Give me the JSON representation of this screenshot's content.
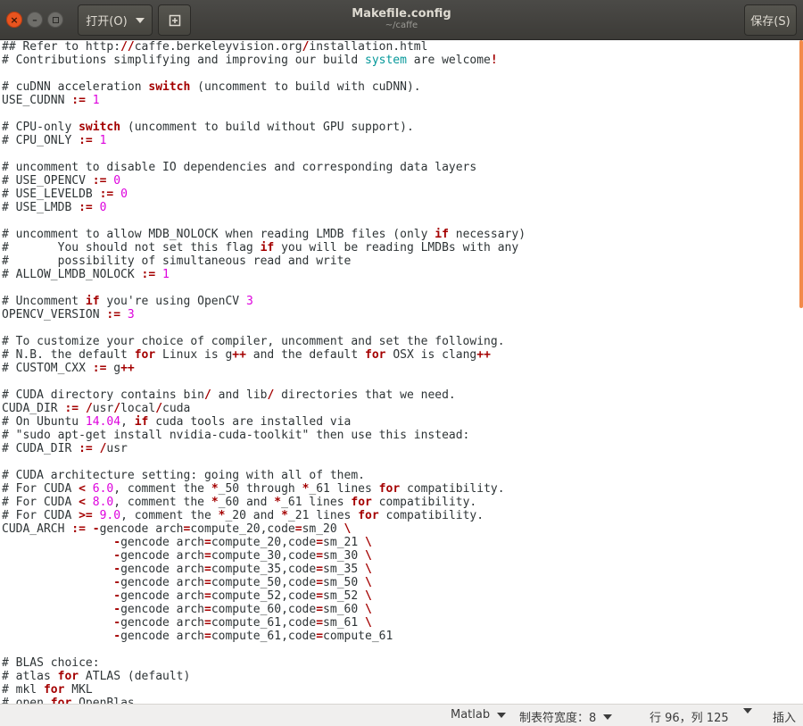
{
  "window": {
    "title": "Makefile.config",
    "subtitle": "~/caffe",
    "close_glyph": "×",
    "min_glyph": "–"
  },
  "toolbar": {
    "open_label": "打开(O)",
    "save_label": "保存(S)",
    "new_tab_icon": "document-new-icon"
  },
  "editor": {
    "lines": [
      [
        {
          "t": "## Refer to http:"
        },
        {
          "t": "//",
          "c": "kw"
        },
        {
          "t": "caffe.berkeleyvision.org"
        },
        {
          "t": "/",
          "c": "kw"
        },
        {
          "t": "installation.html"
        }
      ],
      [
        {
          "t": "# Contributions simplifying and improving our build "
        },
        {
          "t": "system",
          "c": "bi"
        },
        {
          "t": " are welcome"
        },
        {
          "t": "!",
          "c": "kw"
        }
      ],
      [],
      [
        {
          "t": "# cuDNN acceleration "
        },
        {
          "t": "switch",
          "c": "kw"
        },
        {
          "t": " (uncomment to build with cuDNN)."
        }
      ],
      [
        {
          "t": "USE_CUDNN "
        },
        {
          "t": ":=",
          "c": "kw"
        },
        {
          "t": " "
        },
        {
          "t": "1",
          "c": "num"
        }
      ],
      [],
      [
        {
          "t": "# CPU-only "
        },
        {
          "t": "switch",
          "c": "kw"
        },
        {
          "t": " (uncomment to build without GPU support)."
        }
      ],
      [
        {
          "t": "# CPU_ONLY "
        },
        {
          "t": ":=",
          "c": "kw"
        },
        {
          "t": " "
        },
        {
          "t": "1",
          "c": "num"
        }
      ],
      [],
      [
        {
          "t": "# uncomment to disable IO dependencies and corresponding data layers"
        }
      ],
      [
        {
          "t": "# USE_OPENCV "
        },
        {
          "t": ":=",
          "c": "kw"
        },
        {
          "t": " "
        },
        {
          "t": "0",
          "c": "num"
        }
      ],
      [
        {
          "t": "# USE_LEVELDB "
        },
        {
          "t": ":=",
          "c": "kw"
        },
        {
          "t": " "
        },
        {
          "t": "0",
          "c": "num"
        }
      ],
      [
        {
          "t": "# USE_LMDB "
        },
        {
          "t": ":=",
          "c": "kw"
        },
        {
          "t": " "
        },
        {
          "t": "0",
          "c": "num"
        }
      ],
      [],
      [
        {
          "t": "# uncomment to allow MDB_NOLOCK when reading LMDB files (only "
        },
        {
          "t": "if",
          "c": "kw"
        },
        {
          "t": " necessary)"
        }
      ],
      [
        {
          "t": "#       You should not set this flag "
        },
        {
          "t": "if",
          "c": "kw"
        },
        {
          "t": " you will be reading LMDBs with any"
        }
      ],
      [
        {
          "t": "#       possibility of simultaneous read and write"
        }
      ],
      [
        {
          "t": "# ALLOW_LMDB_NOLOCK "
        },
        {
          "t": ":=",
          "c": "kw"
        },
        {
          "t": " "
        },
        {
          "t": "1",
          "c": "num"
        }
      ],
      [],
      [
        {
          "t": "# Uncomment "
        },
        {
          "t": "if",
          "c": "kw"
        },
        {
          "t": " you're using OpenCV "
        },
        {
          "t": "3",
          "c": "num"
        }
      ],
      [
        {
          "t": "OPENCV_VERSION "
        },
        {
          "t": ":=",
          "c": "kw"
        },
        {
          "t": " "
        },
        {
          "t": "3",
          "c": "num"
        }
      ],
      [],
      [
        {
          "t": "# To customize your choice of compiler, uncomment and set the following."
        }
      ],
      [
        {
          "t": "# N.B. the default "
        },
        {
          "t": "for",
          "c": "kw"
        },
        {
          "t": " Linux is g"
        },
        {
          "t": "++",
          "c": "kw"
        },
        {
          "t": " and the default "
        },
        {
          "t": "for",
          "c": "kw"
        },
        {
          "t": " OSX is clang"
        },
        {
          "t": "++",
          "c": "kw"
        }
      ],
      [
        {
          "t": "# CUSTOM_CXX "
        },
        {
          "t": ":=",
          "c": "kw"
        },
        {
          "t": " g"
        },
        {
          "t": "++",
          "c": "kw"
        }
      ],
      [],
      [
        {
          "t": "# CUDA directory contains bin"
        },
        {
          "t": "/",
          "c": "kw"
        },
        {
          "t": " and lib"
        },
        {
          "t": "/",
          "c": "kw"
        },
        {
          "t": " directories that we need."
        }
      ],
      [
        {
          "t": "CUDA_DIR "
        },
        {
          "t": ":=",
          "c": "kw"
        },
        {
          "t": " "
        },
        {
          "t": "/",
          "c": "kw"
        },
        {
          "t": "usr"
        },
        {
          "t": "/",
          "c": "kw"
        },
        {
          "t": "local"
        },
        {
          "t": "/",
          "c": "kw"
        },
        {
          "t": "cuda"
        }
      ],
      [
        {
          "t": "# On Ubuntu "
        },
        {
          "t": "14.04",
          "c": "num"
        },
        {
          "t": ", "
        },
        {
          "t": "if",
          "c": "kw"
        },
        {
          "t": " cuda tools are installed via"
        }
      ],
      [
        {
          "t": "# \"sudo apt-get install nvidia-cuda-toolkit\" then use this instead:"
        }
      ],
      [
        {
          "t": "# CUDA_DIR "
        },
        {
          "t": ":=",
          "c": "kw"
        },
        {
          "t": " "
        },
        {
          "t": "/",
          "c": "kw"
        },
        {
          "t": "usr"
        }
      ],
      [],
      [
        {
          "t": "# CUDA architecture setting: going with all of them."
        }
      ],
      [
        {
          "t": "# For CUDA "
        },
        {
          "t": "<",
          "c": "kw"
        },
        {
          "t": " "
        },
        {
          "t": "6.0",
          "c": "num"
        },
        {
          "t": ", comment the "
        },
        {
          "t": "*",
          "c": "kw"
        },
        {
          "t": "_50 through "
        },
        {
          "t": "*",
          "c": "kw"
        },
        {
          "t": "_61 lines "
        },
        {
          "t": "for",
          "c": "kw"
        },
        {
          "t": " compatibility."
        }
      ],
      [
        {
          "t": "# For CUDA "
        },
        {
          "t": "<",
          "c": "kw"
        },
        {
          "t": " "
        },
        {
          "t": "8.0",
          "c": "num"
        },
        {
          "t": ", comment the "
        },
        {
          "t": "*",
          "c": "kw"
        },
        {
          "t": "_60 and "
        },
        {
          "t": "*",
          "c": "kw"
        },
        {
          "t": "_61 lines "
        },
        {
          "t": "for",
          "c": "kw"
        },
        {
          "t": " compatibility."
        }
      ],
      [
        {
          "t": "# For CUDA "
        },
        {
          "t": ">=",
          "c": "kw"
        },
        {
          "t": " "
        },
        {
          "t": "9.0",
          "c": "num"
        },
        {
          "t": ", comment the "
        },
        {
          "t": "*",
          "c": "kw"
        },
        {
          "t": "_20 and "
        },
        {
          "t": "*",
          "c": "kw"
        },
        {
          "t": "_21 lines "
        },
        {
          "t": "for",
          "c": "kw"
        },
        {
          "t": " compatibility."
        }
      ],
      [
        {
          "t": "CUDA_ARCH "
        },
        {
          "t": ":=",
          "c": "kw"
        },
        {
          "t": " "
        },
        {
          "t": "-",
          "c": "kw"
        },
        {
          "t": "gencode arch"
        },
        {
          "t": "=",
          "c": "kw"
        },
        {
          "t": "compute_20,code"
        },
        {
          "t": "=",
          "c": "kw"
        },
        {
          "t": "sm_20 "
        },
        {
          "t": "\\",
          "c": "kw"
        }
      ],
      [
        {
          "t": "                "
        },
        {
          "t": "-",
          "c": "kw"
        },
        {
          "t": "gencode arch"
        },
        {
          "t": "=",
          "c": "kw"
        },
        {
          "t": "compute_20,code"
        },
        {
          "t": "=",
          "c": "kw"
        },
        {
          "t": "sm_21 "
        },
        {
          "t": "\\",
          "c": "kw"
        }
      ],
      [
        {
          "t": "                "
        },
        {
          "t": "-",
          "c": "kw"
        },
        {
          "t": "gencode arch"
        },
        {
          "t": "=",
          "c": "kw"
        },
        {
          "t": "compute_30,code"
        },
        {
          "t": "=",
          "c": "kw"
        },
        {
          "t": "sm_30 "
        },
        {
          "t": "\\",
          "c": "kw"
        }
      ],
      [
        {
          "t": "                "
        },
        {
          "t": "-",
          "c": "kw"
        },
        {
          "t": "gencode arch"
        },
        {
          "t": "=",
          "c": "kw"
        },
        {
          "t": "compute_35,code"
        },
        {
          "t": "=",
          "c": "kw"
        },
        {
          "t": "sm_35 "
        },
        {
          "t": "\\",
          "c": "kw"
        }
      ],
      [
        {
          "t": "                "
        },
        {
          "t": "-",
          "c": "kw"
        },
        {
          "t": "gencode arch"
        },
        {
          "t": "=",
          "c": "kw"
        },
        {
          "t": "compute_50,code"
        },
        {
          "t": "=",
          "c": "kw"
        },
        {
          "t": "sm_50 "
        },
        {
          "t": "\\",
          "c": "kw"
        }
      ],
      [
        {
          "t": "                "
        },
        {
          "t": "-",
          "c": "kw"
        },
        {
          "t": "gencode arch"
        },
        {
          "t": "=",
          "c": "kw"
        },
        {
          "t": "compute_52,code"
        },
        {
          "t": "=",
          "c": "kw"
        },
        {
          "t": "sm_52 "
        },
        {
          "t": "\\",
          "c": "kw"
        }
      ],
      [
        {
          "t": "                "
        },
        {
          "t": "-",
          "c": "kw"
        },
        {
          "t": "gencode arch"
        },
        {
          "t": "=",
          "c": "kw"
        },
        {
          "t": "compute_60,code"
        },
        {
          "t": "=",
          "c": "kw"
        },
        {
          "t": "sm_60 "
        },
        {
          "t": "\\",
          "c": "kw"
        }
      ],
      [
        {
          "t": "                "
        },
        {
          "t": "-",
          "c": "kw"
        },
        {
          "t": "gencode arch"
        },
        {
          "t": "=",
          "c": "kw"
        },
        {
          "t": "compute_61,code"
        },
        {
          "t": "=",
          "c": "kw"
        },
        {
          "t": "sm_61 "
        },
        {
          "t": "\\",
          "c": "kw"
        }
      ],
      [
        {
          "t": "                "
        },
        {
          "t": "-",
          "c": "kw"
        },
        {
          "t": "gencode arch"
        },
        {
          "t": "=",
          "c": "kw"
        },
        {
          "t": "compute_61,code"
        },
        {
          "t": "=",
          "c": "kw"
        },
        {
          "t": "compute_61"
        }
      ],
      [],
      [
        {
          "t": "# BLAS choice:"
        }
      ],
      [
        {
          "t": "# atlas "
        },
        {
          "t": "for",
          "c": "kw"
        },
        {
          "t": " ATLAS (default)"
        }
      ],
      [
        {
          "t": "# mkl "
        },
        {
          "t": "for",
          "c": "kw"
        },
        {
          "t": " MKL"
        }
      ],
      [
        {
          "t": "# open "
        },
        {
          "t": "for",
          "c": "kw"
        },
        {
          "t": " OpenBlas"
        }
      ]
    ]
  },
  "status": {
    "language": "Matlab",
    "tab_width": "制表符宽度：8",
    "position": "行 96，列 125",
    "insert_mode": "插入"
  },
  "colors": {
    "keyword": "#a40000",
    "number": "#dd00dd",
    "builtin": "#06989a",
    "text": "#2e3436",
    "accent": "#e9541f"
  }
}
